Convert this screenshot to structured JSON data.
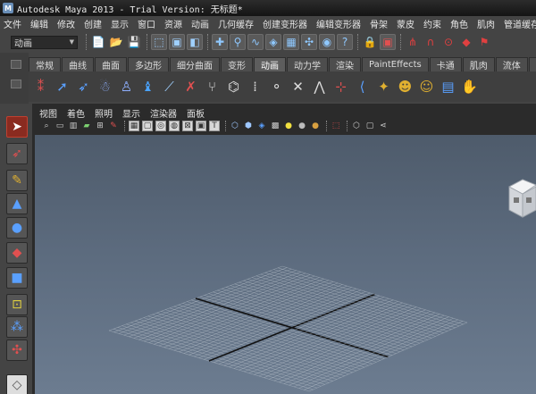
{
  "window": {
    "title": "Autodesk Maya 2013 - Trial Version: 无标题*",
    "logo_letter": "M"
  },
  "menubar": {
    "items": [
      "文件",
      "编辑",
      "修改",
      "创建",
      "显示",
      "窗口",
      "资源",
      "动画",
      "几何缓存",
      "创建变形器",
      "编辑变形器",
      "骨架",
      "蒙皮",
      "约束",
      "角色",
      "肌肉",
      "管道缓存"
    ]
  },
  "statusline": {
    "mode_value": "动画"
  },
  "shelf": {
    "tabs": [
      "常规",
      "曲线",
      "曲面",
      "多边形",
      "细分曲面",
      "变形",
      "动画",
      "动力学",
      "渲染",
      "PaintEffects",
      "卡通",
      "肌肉",
      "流体",
      "毛"
    ],
    "active_tab": "动画"
  },
  "panel": {
    "menu": [
      "视图",
      "着色",
      "照明",
      "显示",
      "渲染器",
      "面板"
    ]
  },
  "colors": {
    "accent_tool": "#8a2b20",
    "grid_line": "#b9c2cc",
    "axis_line": "#111111"
  }
}
